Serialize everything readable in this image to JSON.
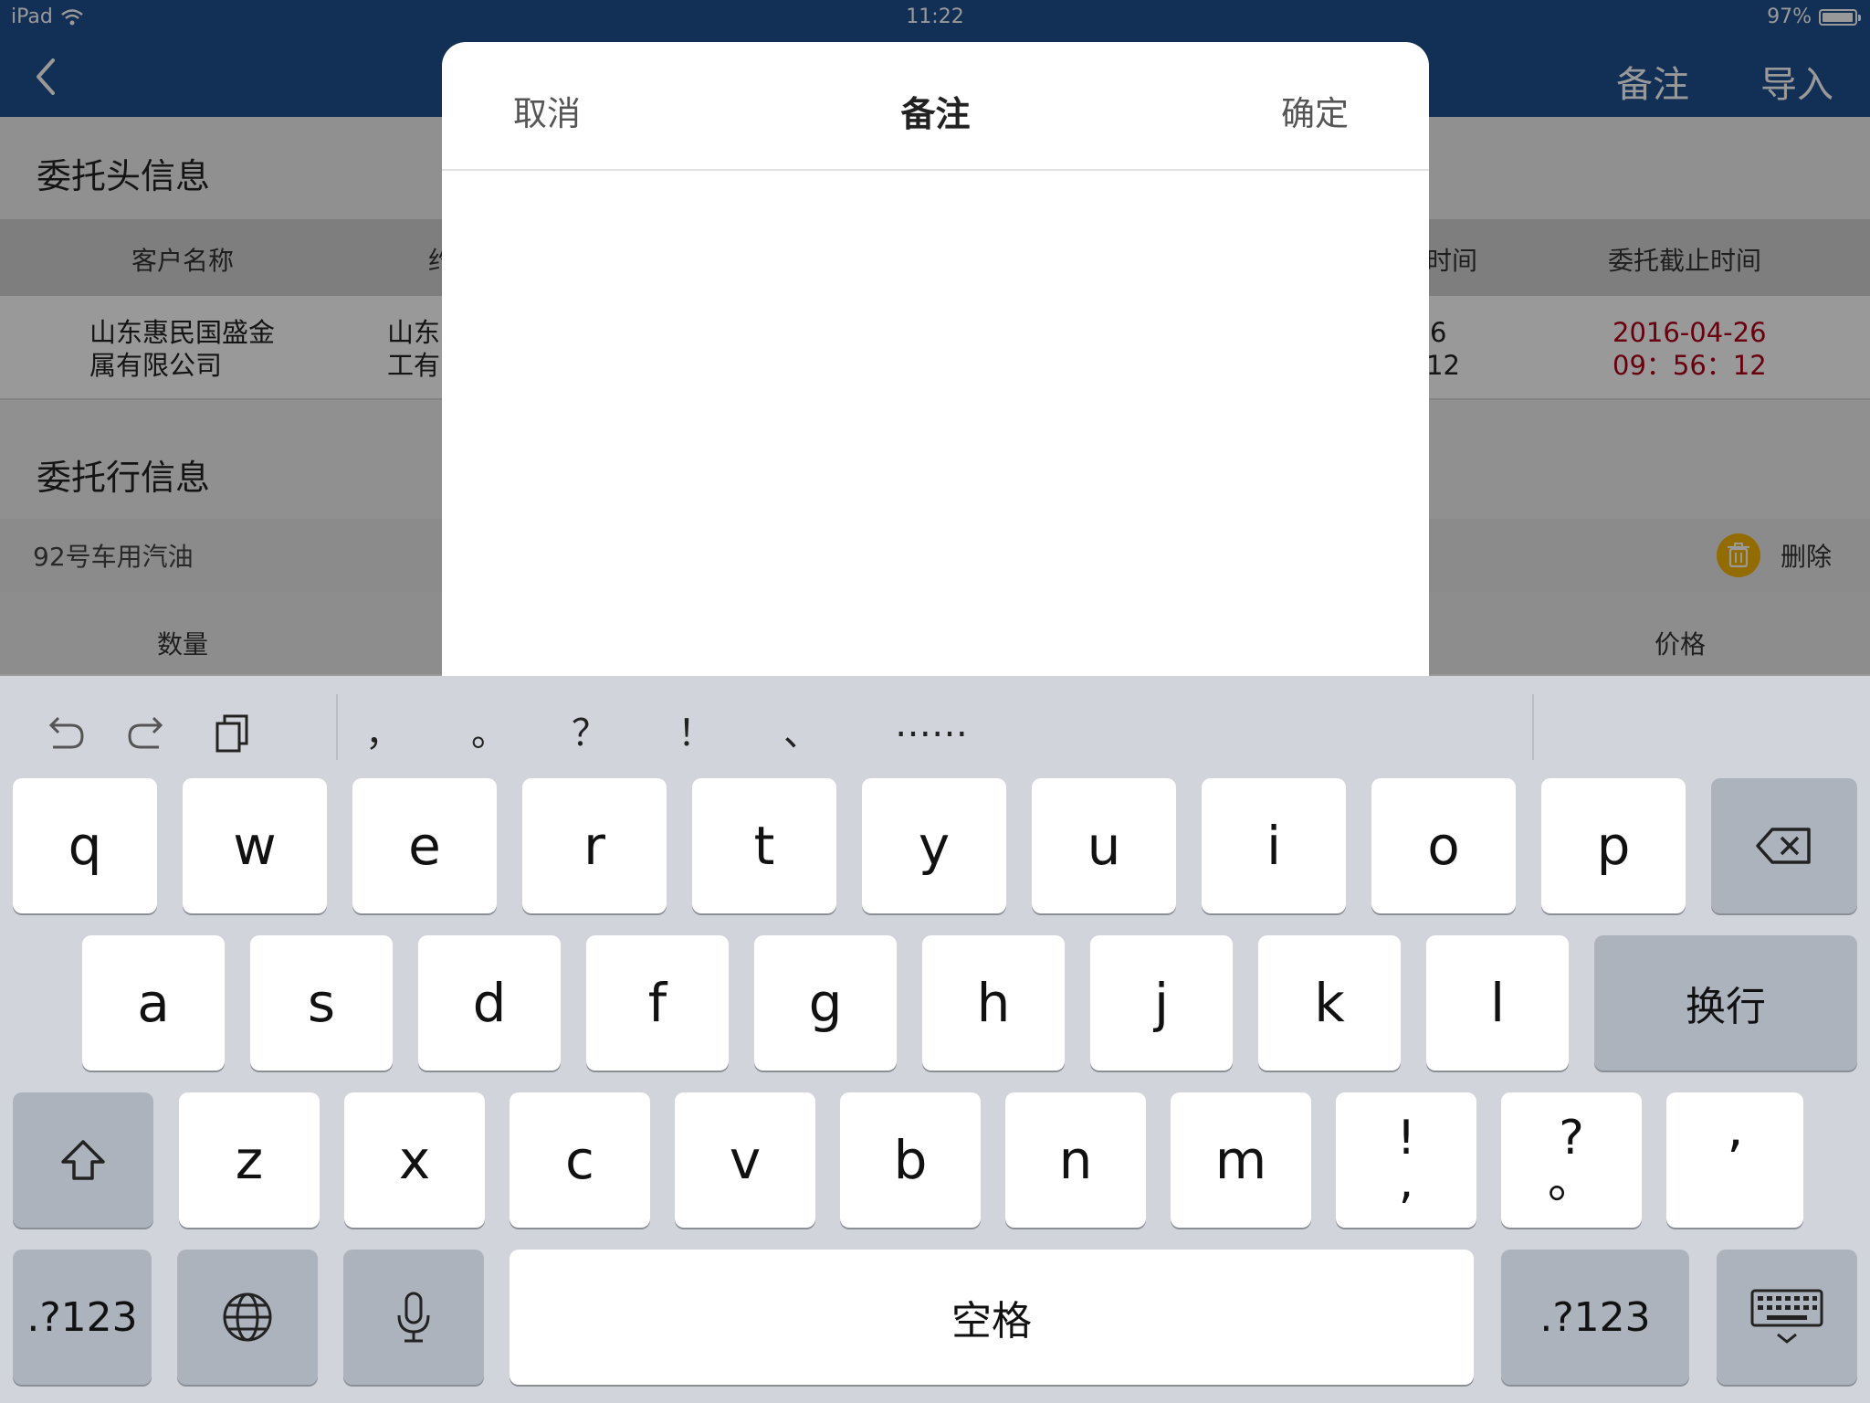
{
  "status_bar": {
    "device": "iPad",
    "time": "11:22",
    "battery": "97%",
    "battery_level": 0.97
  },
  "nav": {
    "remark_label": "备注",
    "import_label": "导入"
  },
  "header_section": {
    "title": "委托头信息",
    "columns": [
      "客户名称",
      "约",
      "时间",
      "委托截止时间"
    ],
    "row": {
      "customer_line1": "山东惠民国盛金",
      "customer_line2": "属有限公司",
      "col2_line1": "山东",
      "col2_line2": "工有",
      "col3_line1": "6",
      "col3_line2": "12",
      "deadline_line1": "2016-04-26",
      "deadline_line2": "09：56：12"
    }
  },
  "line_section": {
    "title": "委托行信息",
    "item_name": "92号车用汽油",
    "delete_label": "删除",
    "columns": [
      "数量",
      "价格"
    ]
  },
  "modal": {
    "cancel_label": "取消",
    "title": "备注",
    "confirm_label": "确定",
    "text_value": ""
  },
  "keyboard": {
    "punctuation": [
      "，",
      "。",
      "？",
      "！",
      "、",
      "……"
    ],
    "row1": [
      "q",
      "w",
      "e",
      "r",
      "t",
      "y",
      "u",
      "i",
      "o",
      "p"
    ],
    "row2": [
      "a",
      "s",
      "d",
      "f",
      "g",
      "h",
      "j",
      "k",
      "l"
    ],
    "return_label": "换行",
    "row3": [
      "z",
      "x",
      "c",
      "v",
      "b",
      "n",
      "m"
    ],
    "row3_extra": [
      {
        "top": "!",
        "bottom": ","
      },
      {
        "top": "?",
        "bottom": "。"
      }
    ],
    "apostrophe": "’",
    "numbers_label": ".?123",
    "space_label": "空格"
  },
  "colors": {
    "nav_blue": "#1f4f8f",
    "deadline_red": "#b0001a",
    "delete_yellow": "#f5b400",
    "keyboard_bg": "#d1d5db"
  },
  "icons": [
    "back-chevron-icon",
    "wifi-icon",
    "battery-icon",
    "trash-icon",
    "undo-icon",
    "redo-icon",
    "clipboard-icon",
    "backspace-icon",
    "shift-icon",
    "globe-icon",
    "microphone-icon",
    "keyboard-dismiss-icon"
  ]
}
